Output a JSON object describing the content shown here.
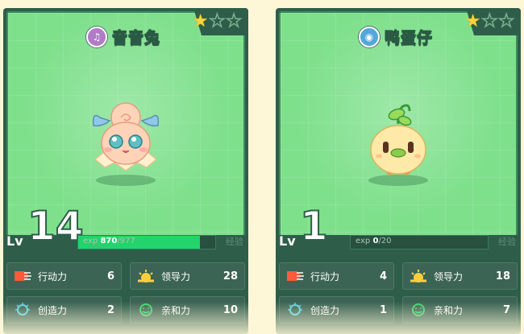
{
  "cards": [
    {
      "name": "音音兔",
      "type_icon": "music-type-icon",
      "type_color": "#b07cc6",
      "stars": {
        "filled": 1,
        "total": 3
      },
      "level_label": "Lv",
      "level": "14",
      "exp_label": "exp",
      "exp_current": "870",
      "exp_max": "/977",
      "exp_fraction": 0.89,
      "evolve_label": "经验",
      "stats": [
        {
          "icon": "speed-icon",
          "label": "行动力",
          "value": "6"
        },
        {
          "icon": "leadership-icon",
          "label": "领导力",
          "value": "28"
        },
        {
          "icon": "creativity-icon",
          "label": "创造力",
          "value": "2"
        },
        {
          "icon": "affinity-icon",
          "label": "亲和力",
          "value": "10"
        }
      ]
    },
    {
      "name": "鸭蛋仔",
      "type_icon": "water-type-icon",
      "type_color": "#52a8d8",
      "stars": {
        "filled": 1,
        "total": 3
      },
      "level_label": "Lv",
      "level": "1",
      "exp_label": "exp",
      "exp_current": "0",
      "exp_max": "/20",
      "exp_fraction": 0.0,
      "evolve_label": "经验",
      "stats": [
        {
          "icon": "speed-icon",
          "label": "行动力",
          "value": "4"
        },
        {
          "icon": "leadership-icon",
          "label": "领导力",
          "value": "18"
        },
        {
          "icon": "creativity-icon",
          "label": "创造力",
          "value": "1"
        },
        {
          "icon": "affinity-icon",
          "label": "亲和力",
          "value": "7"
        }
      ]
    }
  ]
}
